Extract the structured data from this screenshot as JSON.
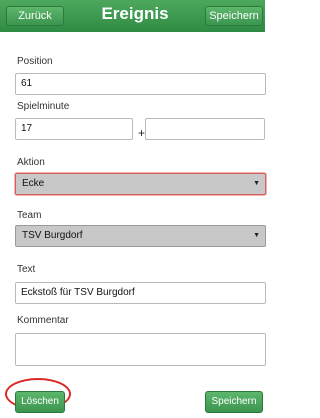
{
  "header": {
    "back_label": "Zurück",
    "title": "Ereignis",
    "save_label": "Speichern"
  },
  "form": {
    "position": {
      "label": "Position",
      "value": "61"
    },
    "spielminute": {
      "label": "Spielminute",
      "value": "17",
      "separator": "+",
      "extra_value": ""
    },
    "aktion": {
      "label": "Aktion",
      "value": "Ecke"
    },
    "team": {
      "label": "Team",
      "value": "TSV Burgdorf"
    },
    "text": {
      "label": "Text",
      "value": "Eckstoß für TSV Burgdorf"
    },
    "kommentar": {
      "label": "Kommentar",
      "value": ""
    }
  },
  "footer": {
    "delete_label": "Löschen",
    "save_label": "Speichern"
  },
  "colors": {
    "header_green": "#2f8a43",
    "button_green": "#3c9550",
    "highlight_red": "#d92a2a"
  },
  "icons": {
    "dropdown": "triangle-down-icon"
  }
}
